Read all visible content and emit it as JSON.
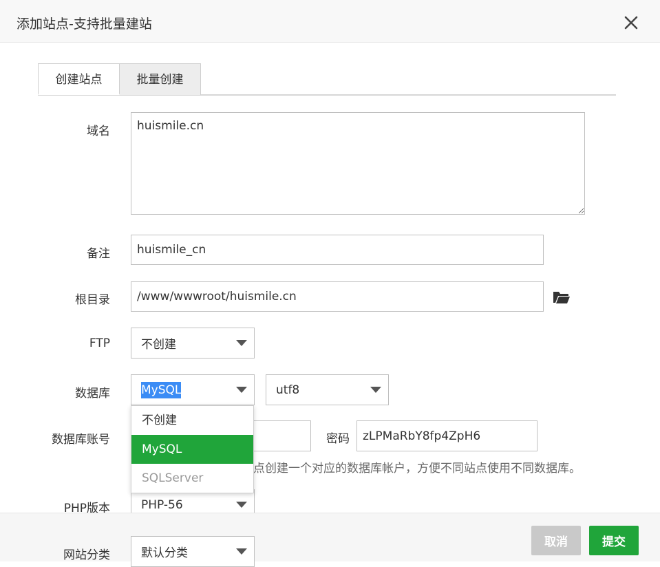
{
  "dialog": {
    "title": "添加站点-支持批量建站"
  },
  "tabs": [
    {
      "label": "创建站点",
      "active": true
    },
    {
      "label": "批量创建",
      "active": false
    }
  ],
  "form": {
    "domain": {
      "label": "域名",
      "value": "huismile.cn"
    },
    "remark": {
      "label": "备注",
      "value": "huismile_cn"
    },
    "root": {
      "label": "根目录",
      "value": "/www/wwwroot/huismile.cn"
    },
    "ftp": {
      "label": "FTP",
      "selected": "不创建"
    },
    "database": {
      "label": "数据库",
      "selected": "MySQL",
      "charset": "utf8"
    },
    "db_account": {
      "label": "数据库账号",
      "password_label": "密码",
      "password_value": "zLPMaRbY8fp4ZpH6"
    },
    "db_hint": "点创建一个对应的数据库帐户，方便不同站点使用不同数据库。",
    "php": {
      "label": "PHP版本",
      "selected": "PHP-56"
    },
    "category": {
      "label": "网站分类",
      "selected": "默认分类"
    }
  },
  "database_dropdown": {
    "options": [
      "不创建",
      "MySQL",
      "SQLServer"
    ],
    "selected_index": 1
  },
  "footer": {
    "cancel_label": "取消",
    "submit_label": "提交"
  },
  "colors": {
    "accent": "#20a53a",
    "highlight": "#3b8cf5",
    "cancel": "#c9c9c9"
  }
}
